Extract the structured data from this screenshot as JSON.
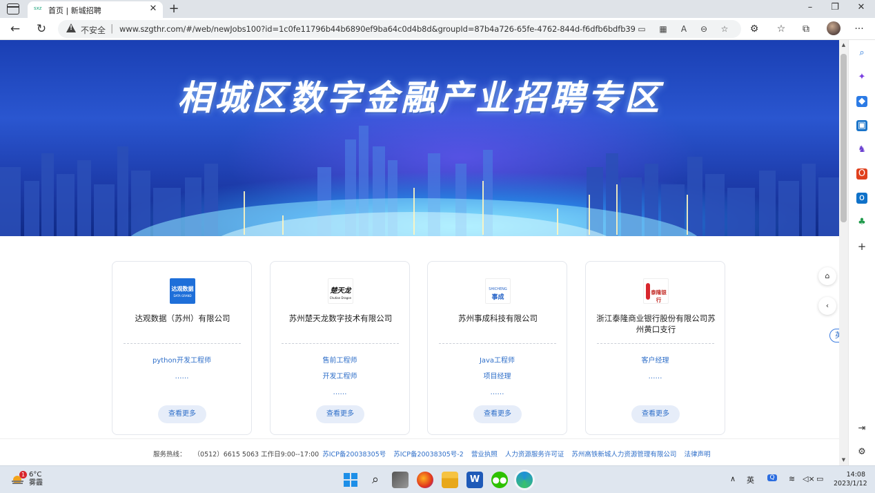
{
  "browser": {
    "tab": {
      "favicon_text": "sxz",
      "title": "首页 | 新城招聘"
    },
    "address": {
      "security_label": "不安全",
      "separator": "|",
      "url": "www.szgthr.com/#/web/newJobs100?id=1c0fe11796b44b6890ef9ba64c0d4b8d&groupId=87b4a726-65fe-4762-844d-f6dfb6bdfb39"
    }
  },
  "page": {
    "banner_title": "相城区数字金融产业招聘专区",
    "cards": [
      {
        "company": "达观数据（苏州）有限公司",
        "logo_text": "达观数据",
        "logo_sub": "DATA GRAND",
        "jobs": [
          "python开发工程师",
          "……"
        ],
        "more": "查看更多"
      },
      {
        "company": "苏州楚天龙数字技术有限公司",
        "logo_text": "楚天龙",
        "logo_sub": "Chutian Dragon",
        "jobs": [
          "售前工程师",
          "开发工程师",
          "……"
        ],
        "more": "查看更多"
      },
      {
        "company": "苏州事成科技有限公司",
        "logo_text": "事成",
        "logo_sub": "SHICHENG",
        "jobs": [
          "Java工程师",
          "项目经理",
          "……"
        ],
        "more": "查看更多"
      },
      {
        "company": "浙江泰隆商业银行股份有限公司苏州黄口支行",
        "logo_text": "泰隆银行",
        "logo_sub": "",
        "jobs": [
          "客户经理",
          "……"
        ],
        "more": "查看更多"
      }
    ],
    "side": {
      "home_icon": "home-icon",
      "back_icon": "chevron-left-icon",
      "lang": "英"
    },
    "footer": {
      "hotline_label": "服务热线：",
      "hotline": "（0512）6615 5063 工作日9:00--17:00",
      "links": [
        "苏ICP备20038305号",
        "苏ICP备20038305号-2",
        "营业执照",
        "人力资源服务许可证",
        "苏州高铁新城人力资源管理有限公司",
        "法律声明"
      ]
    }
  },
  "taskbar": {
    "weather": {
      "temp": "6°C",
      "desc": "雾霾",
      "badge": "1"
    },
    "ime": "英",
    "time": "14:08",
    "date": "2023/1/12"
  },
  "colors": {
    "link": "#2f6fc9",
    "banner": "#1e45c0"
  }
}
